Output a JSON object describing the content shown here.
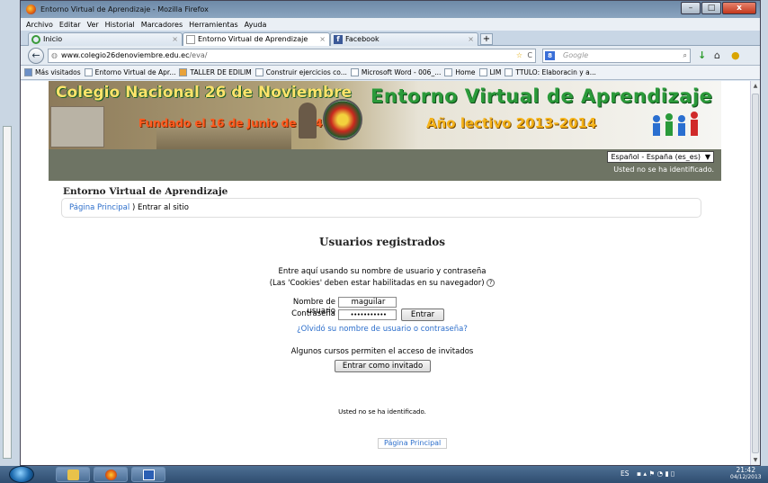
{
  "window": {
    "title": "Entorno Virtual de Aprendizaje - Mozilla Firefox",
    "controls": {
      "minimize": "–",
      "maximize": "□",
      "close": "x"
    }
  },
  "menu": [
    "Archivo",
    "Editar",
    "Ver",
    "Historial",
    "Marcadores",
    "Herramientas",
    "Ayuda"
  ],
  "tabs": [
    {
      "label": "Inicio",
      "close": "×"
    },
    {
      "label": "Entorno Virtual de Aprendizaje",
      "close": "×"
    },
    {
      "label": "Facebook",
      "close": "×"
    }
  ],
  "new_tab": "+",
  "nav": {
    "back": "←",
    "url_domain": "www.colegio26denoviembre.edu.ec",
    "url_path": "/eva/",
    "star": "☆",
    "reload": "C",
    "search_engine": "8",
    "search_placeholder": "Google",
    "search_icon": "⌕",
    "download_icon": "↓",
    "home_icon": "⌂",
    "addon_icon": "●"
  },
  "bookmarks": [
    "Más visitados",
    "Entorno Virtual de Apr...",
    "TALLER DE EDILIM",
    "Construir ejercicios co...",
    "Microsoft Word - 006_...",
    "Home",
    "LIM",
    "TTULO: Elaboracin y a..."
  ],
  "banner": {
    "school": "Colegio Nacional 26 de Noviembre",
    "founded": "Fundado el 16 de Junio de 1941",
    "eva": "Entorno Virtual de Aprendizaje",
    "year": "Año lectivo 2013-2014"
  },
  "lang": {
    "selected": "Español - España (es_es)",
    "dropdown": "▼",
    "not_logged_top": "Usted no se ha identificado."
  },
  "page": {
    "heading": "Entorno Virtual de Aprendizaje",
    "breadcrumb_home": "Página Principal",
    "breadcrumb_sep": ")",
    "breadcrumb_current": "Entrar al sitio"
  },
  "login": {
    "title": "Usuarios registrados",
    "intro": "Entre aquí usando su nombre de usuario y contraseña",
    "cookies": "(Las 'Cookies' deben estar habilitadas en su navegador)",
    "help": "?",
    "username_label": "Nombre de usuario",
    "username_value": "maguilar",
    "password_label": "Contraseña",
    "password_value": "•••••••••••",
    "submit": "Entrar",
    "forgot": "¿Olvidó su nombre de usuario o contraseña?",
    "guest_text": "Algunos cursos permiten el acceso de invitados",
    "guest_button": "Entrar como invitado"
  },
  "footer": {
    "not_logged": "Usted no se ha identificado.",
    "home_link": "Página Principal"
  },
  "taskbar": {
    "tray": "ES",
    "time": "21:42",
    "date": "04/12/2013"
  }
}
